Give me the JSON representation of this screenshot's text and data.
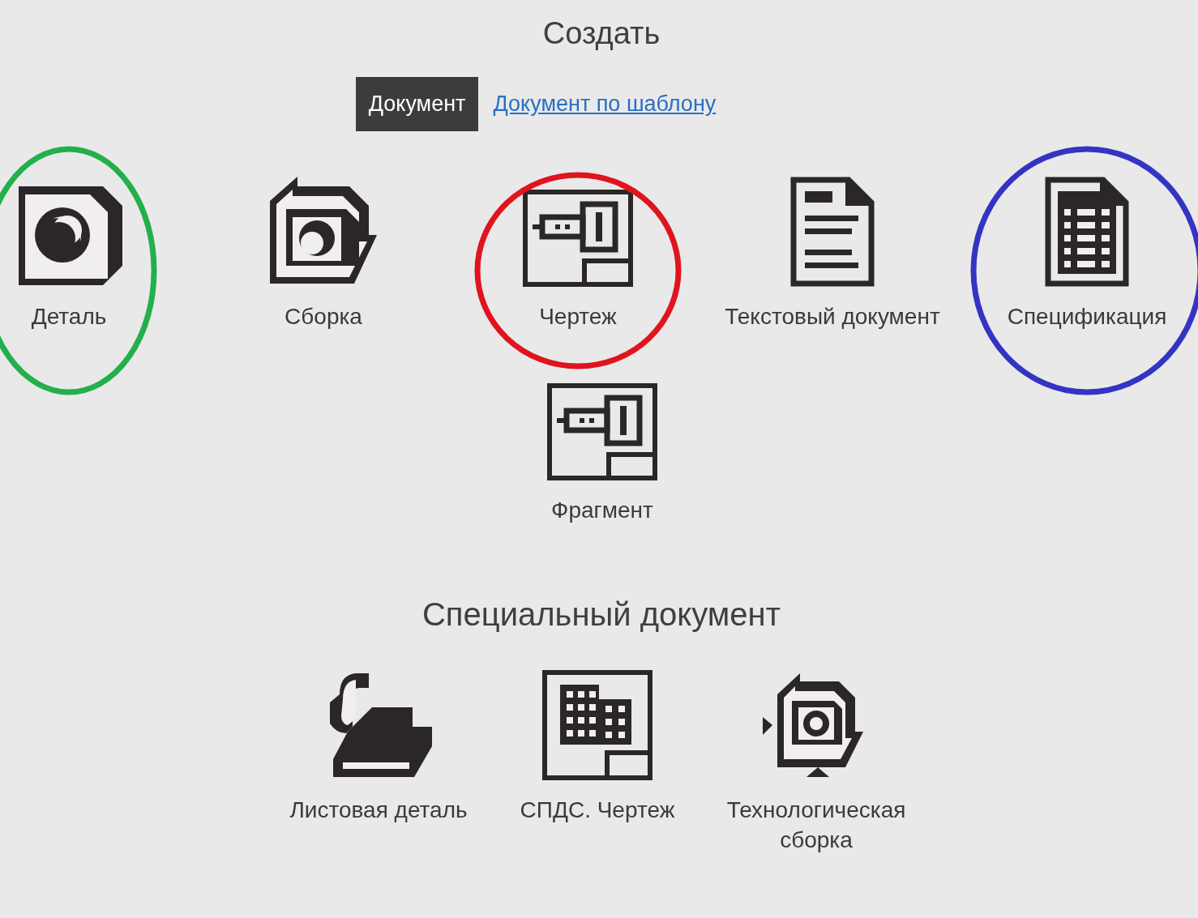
{
  "title": "Создать",
  "tabs": [
    {
      "label": "Документ",
      "selected": true
    },
    {
      "label": "Документ по шаблону",
      "selected": false
    }
  ],
  "documents": [
    {
      "label": "Деталь",
      "color": "#22b04a"
    },
    {
      "label": "Сборка"
    },
    {
      "label": "Чертеж",
      "color": "#e0141e"
    },
    {
      "label": "Текстовый документ"
    },
    {
      "label": "Спецификация",
      "color": "#3434c4"
    },
    {
      "label": "Фрагмент"
    }
  ],
  "special_heading": "Специальный документ",
  "special_documents": [
    {
      "label": "Листовая деталь"
    },
    {
      "label": "СПДС. Чертеж"
    },
    {
      "label": "Технологическая сборка"
    }
  ]
}
